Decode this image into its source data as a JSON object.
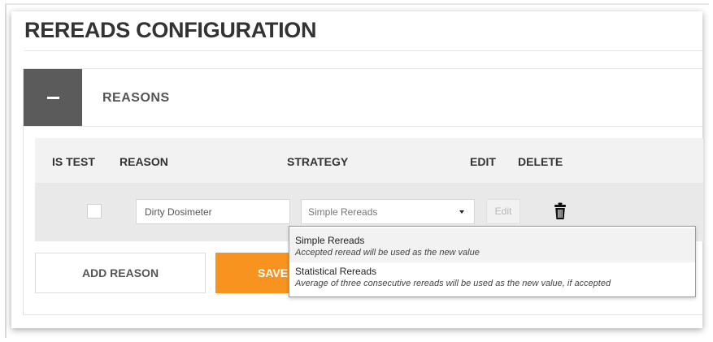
{
  "page": {
    "title": "REREADS CONFIGURATION"
  },
  "section": {
    "title": "REASONS",
    "collapse_symbol": "−"
  },
  "table": {
    "columns": [
      "IS TEST",
      "REASON",
      "STRATEGY",
      "EDIT",
      "DELETE"
    ],
    "rows": [
      {
        "is_test": false,
        "reason": "Dirty Dosimeter",
        "strategy": "Simple Rereads",
        "edit_label": "Edit",
        "delete_icon": "trash-icon"
      }
    ]
  },
  "buttons": {
    "add_reason": "ADD REASON",
    "save": "SAVE"
  },
  "dropdown": {
    "options": [
      {
        "title": "Simple Rereads",
        "description": "Accepted reread will be used as the new value"
      },
      {
        "title": "Statistical Rereads",
        "description": "Average of three consecutive rereads will be used as the new value, if accepted"
      }
    ]
  },
  "colors": {
    "accent_orange": "#f7931e",
    "collapse_gray": "#5b5b5b",
    "header_bg": "#f2f2f2",
    "row_bg": "#e9e9e9"
  }
}
